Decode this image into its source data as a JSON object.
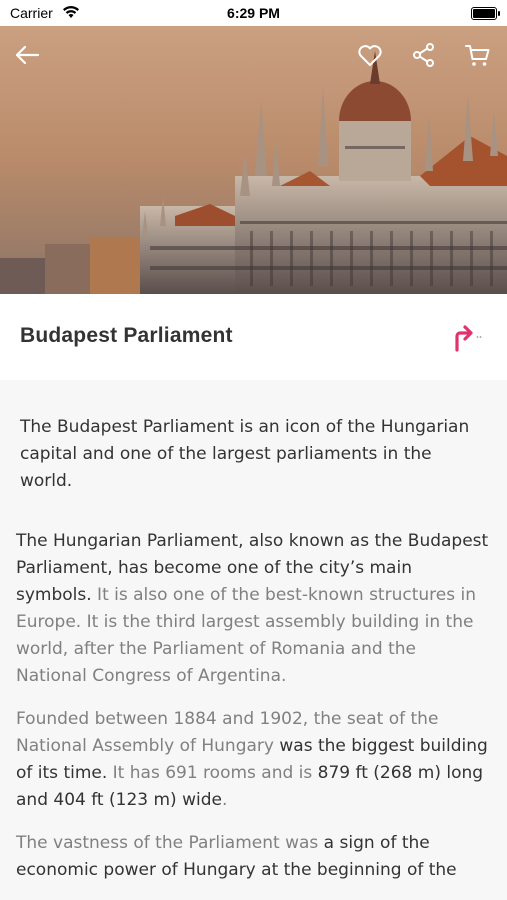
{
  "status_bar": {
    "carrier": "Carrier",
    "time": "6:29 PM"
  },
  "header": {
    "back_icon": "arrow-left-icon",
    "favorite_icon": "heart-icon",
    "share_icon": "share-icon",
    "cart_icon": "cart-icon"
  },
  "place": {
    "title": "Budapest Parliament",
    "directions_icon": "turn-right-arrow-icon",
    "accent_color": "#e0336e"
  },
  "intro": "The Budapest Parliament is an icon of the Hungarian capital and one of the largest parliaments in the world.",
  "paragraphs": [
    [
      {
        "t": "The Hungarian Parliament, also known as the Budapest Parliament, has become one of the city’s main symbols.",
        "b": true
      },
      {
        "t": " It is also one of the best-known structures in Europe. It is the third largest assembly building in the world, after the Parliament of Romania and the National Congress of Argentina.",
        "b": false
      }
    ],
    [
      {
        "t": "Founded between 1884 and 1902, the seat of the National Assembly of Hungary ",
        "b": false
      },
      {
        "t": "was the biggest building of its time.",
        "b": true
      },
      {
        "t": " It has 691 rooms and is ",
        "b": false
      },
      {
        "t": "879 ft (268 m) long and 404 ft (123 m) wide",
        "b": true
      },
      {
        "t": ".",
        "b": false
      }
    ],
    [
      {
        "t": "The vastness of the Parliament was ",
        "b": false
      },
      {
        "t": "a sign of the economic power of Hungary at the beginning of the",
        "b": true
      }
    ]
  ]
}
